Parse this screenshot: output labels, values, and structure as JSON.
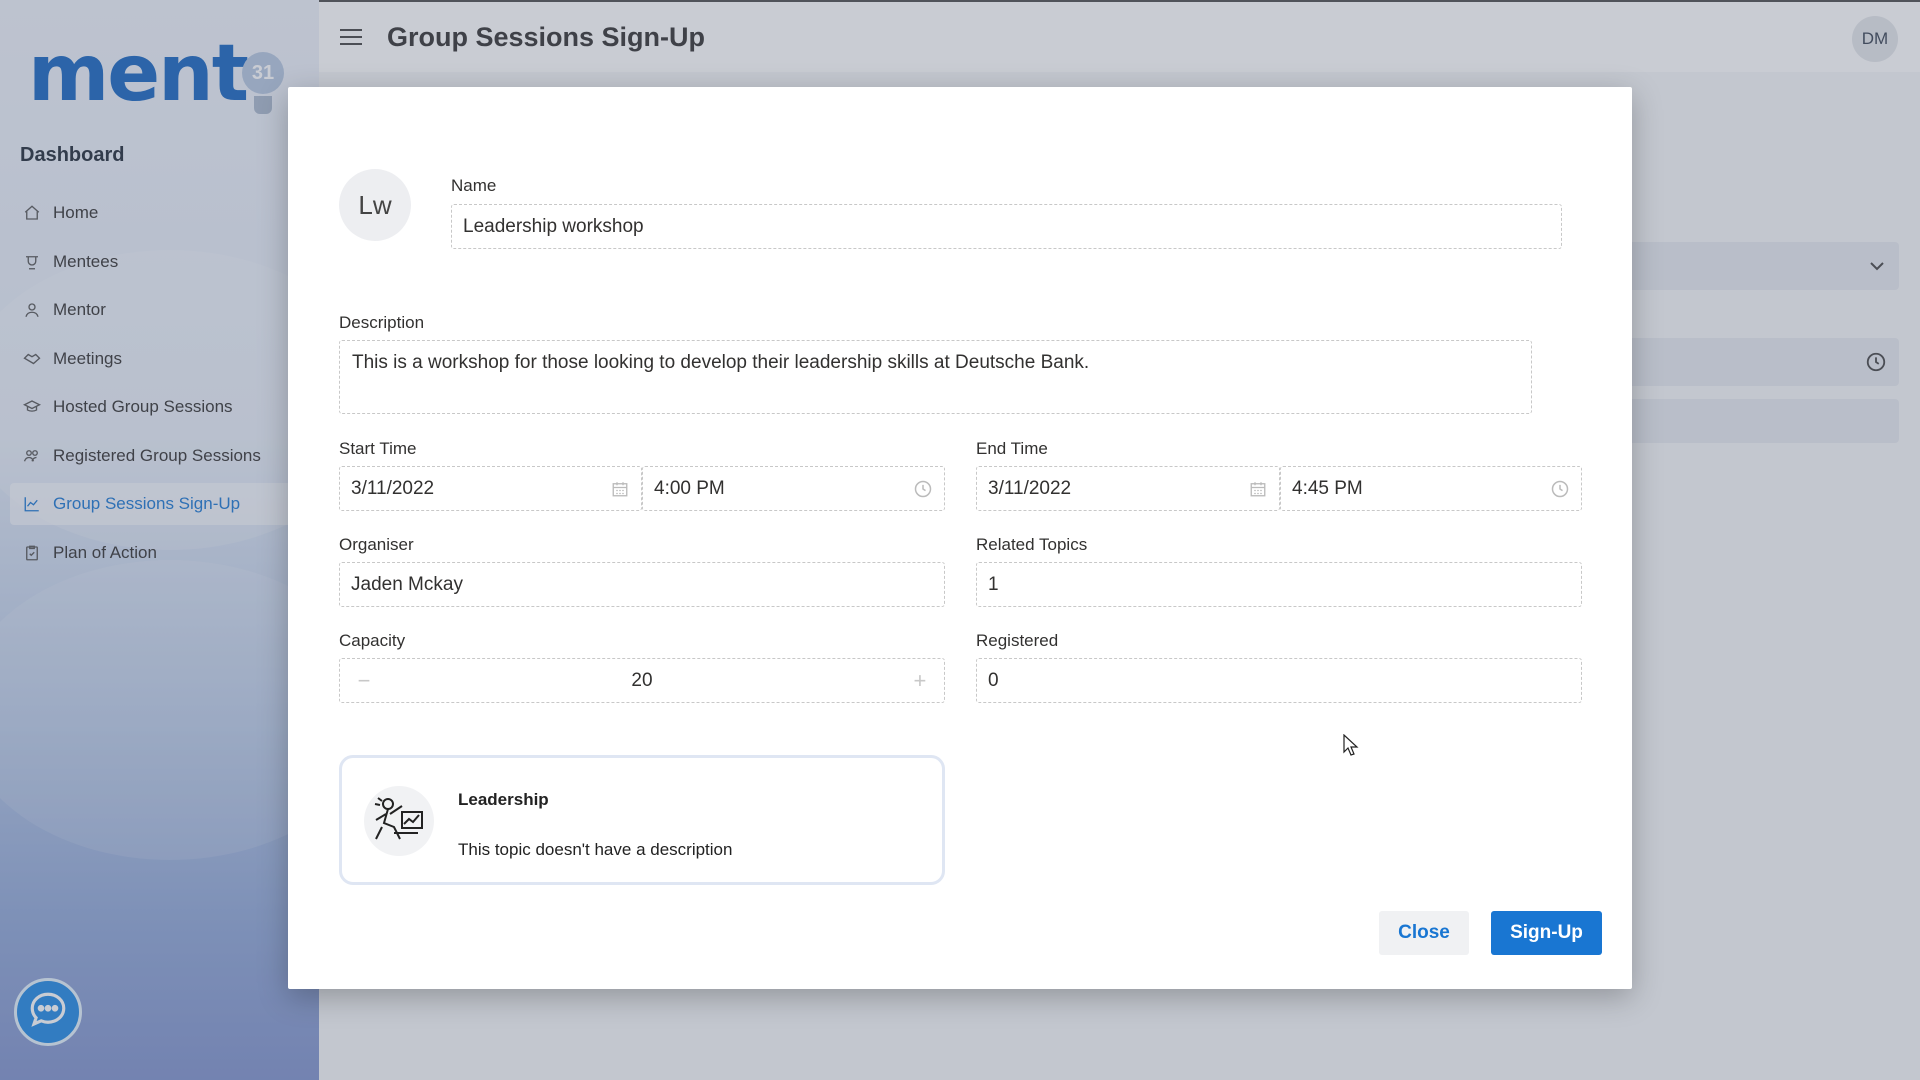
{
  "app": {
    "logo_text": "ment",
    "logo_badge": "31",
    "page_title": "Group Sessions Sign-Up",
    "user_initials": "DM"
  },
  "sidebar": {
    "section_title": "Dashboard",
    "items": [
      {
        "label": "Home",
        "icon": "home-icon"
      },
      {
        "label": "Mentees",
        "icon": "mentees-icon"
      },
      {
        "label": "Mentor",
        "icon": "person-icon"
      },
      {
        "label": "Meetings",
        "icon": "handshake-icon"
      },
      {
        "label": "Hosted Group Sessions",
        "icon": "graduation-cap-icon"
      },
      {
        "label": "Registered Group Sessions",
        "icon": "group-icon"
      },
      {
        "label": "Group Sessions Sign-Up",
        "icon": "chart-icon",
        "active": true
      },
      {
        "label": "Plan of Action",
        "icon": "clipboard-icon"
      }
    ]
  },
  "modal": {
    "avatar_initials": "Lw",
    "name_label": "Name",
    "name_value": "Leadership workshop",
    "description_label": "Description",
    "description_value": "This is a workshop for those looking to develop their leadership skills at Deutsche Bank.",
    "start_time_label": "Start Time",
    "start_date": "3/11/2022",
    "start_time": "4:00 PM",
    "end_time_label": "End Time",
    "end_date": "3/11/2022",
    "end_time": "4:45 PM",
    "organiser_label": "Organiser",
    "organiser_value": "Jaden Mckay",
    "related_topics_label": "Related Topics",
    "related_topics_value": "1",
    "capacity_label": "Capacity",
    "capacity_value": "20",
    "registered_label": "Registered",
    "registered_value": "0",
    "topic": {
      "title": "Leadership",
      "description": "This topic doesn't have a description"
    },
    "close_label": "Close",
    "signup_label": "Sign-Up"
  },
  "colors": {
    "accent": "#1976d2",
    "logo": "#1565c0"
  }
}
